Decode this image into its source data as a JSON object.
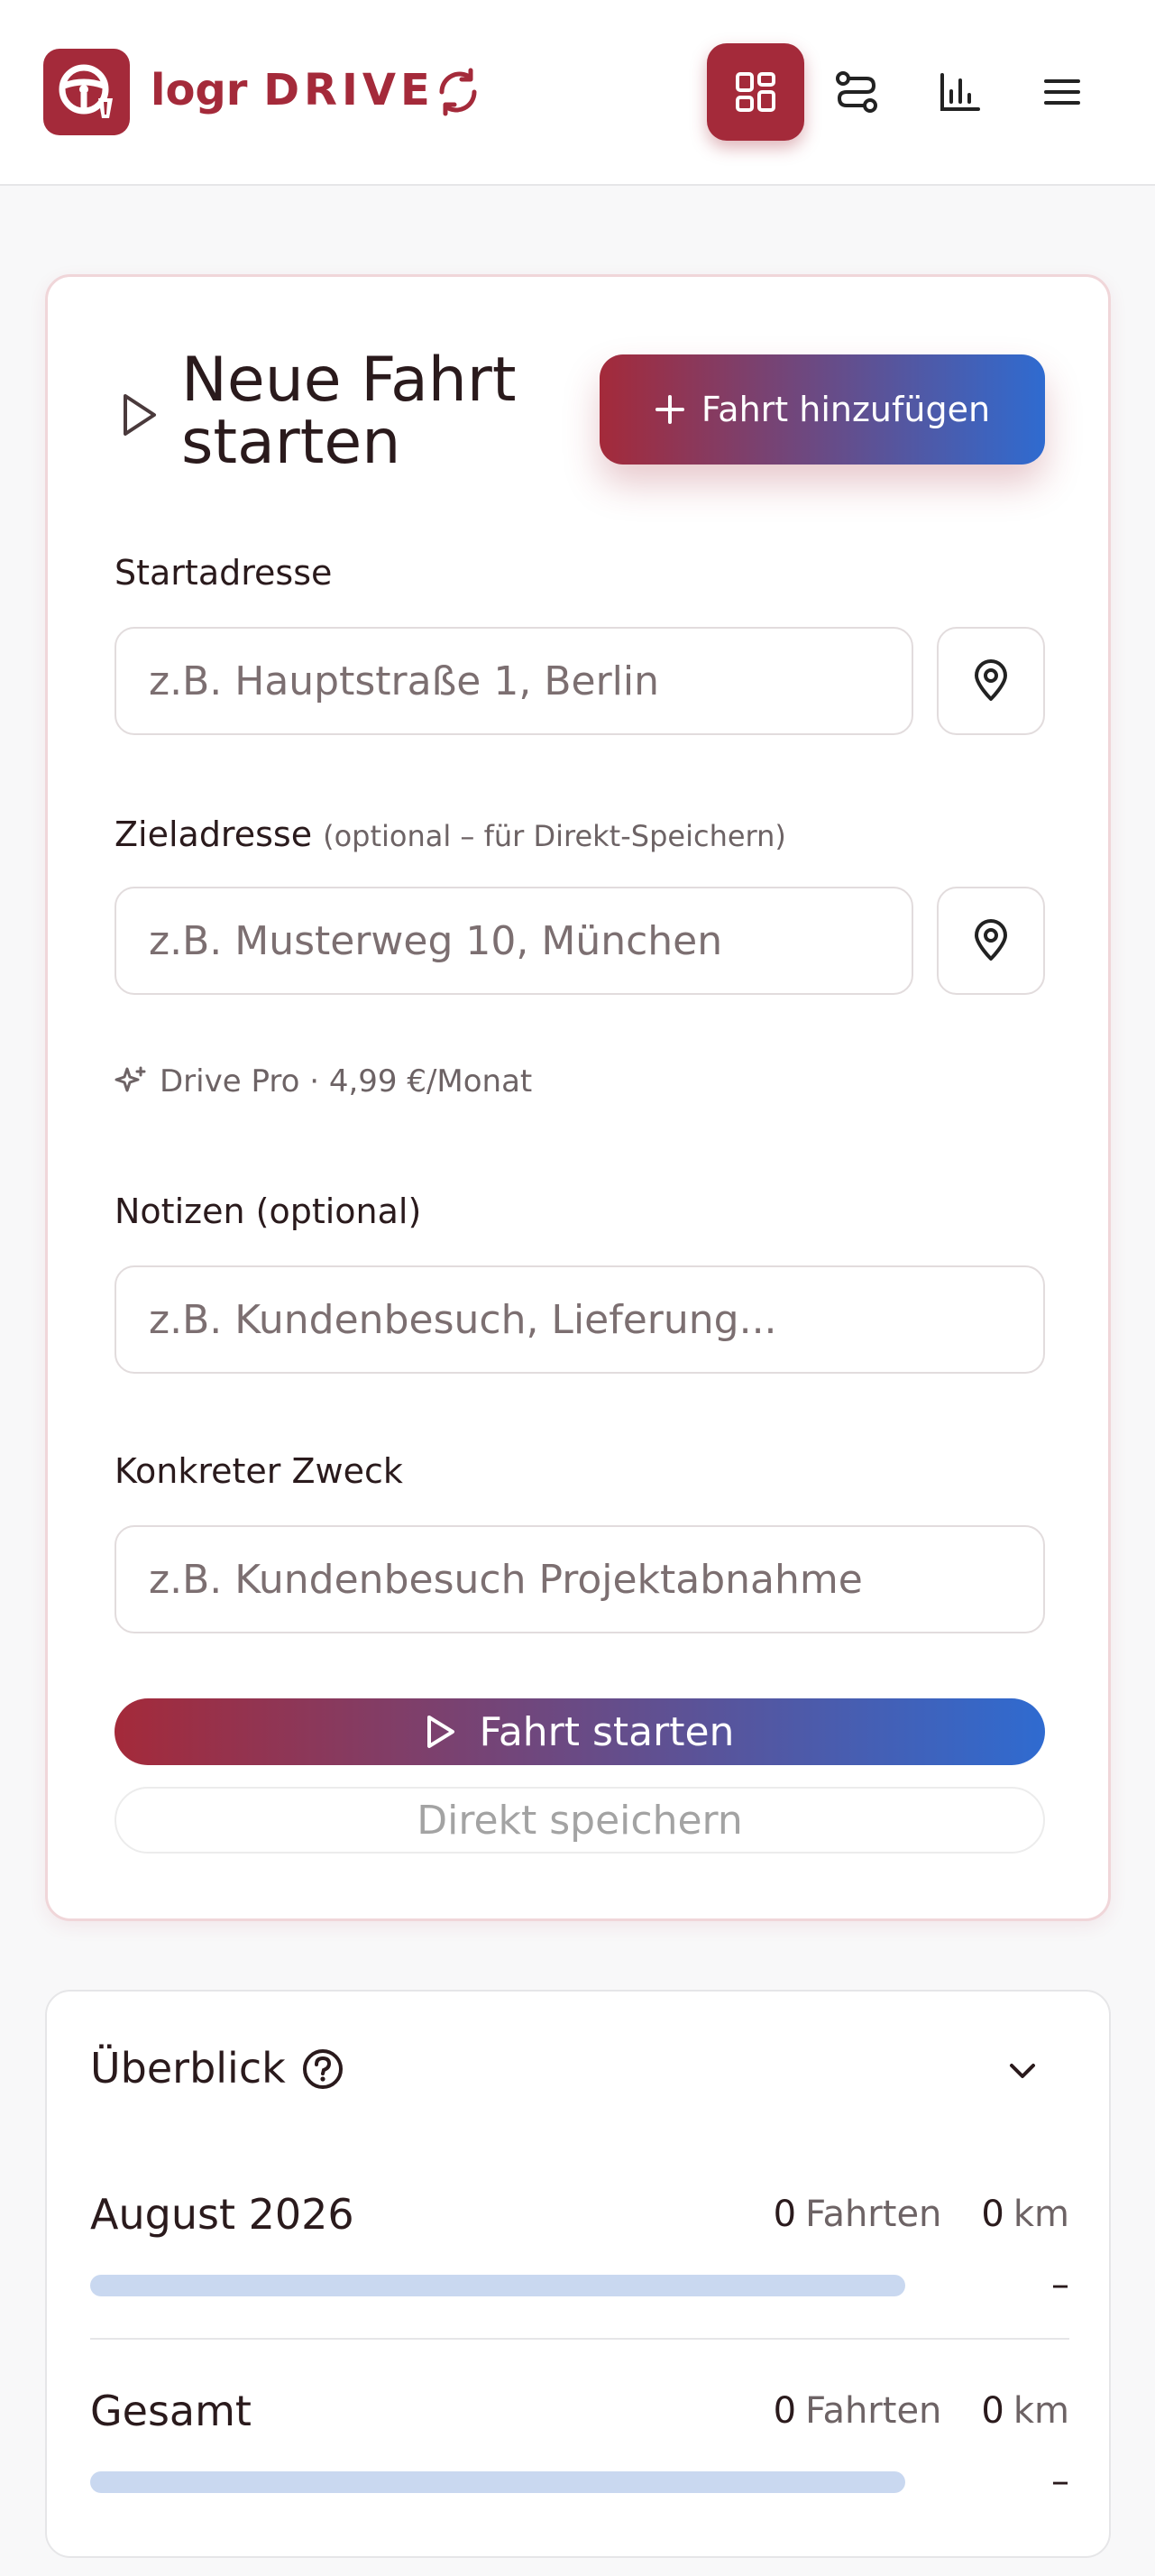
{
  "header": {
    "brand_part1": "logr",
    "brand_part2": "DRIVE",
    "nav": [
      "dashboard",
      "routes",
      "statistics",
      "menu"
    ],
    "colors": {
      "accent": "#a42a3a",
      "gradient_end": "#2f6bd0"
    }
  },
  "trip_form": {
    "title": "Neue Fahrt starten",
    "add_button": "Fahrt hinzufügen",
    "start_address": {
      "label": "Startadresse",
      "placeholder": "z.B. Hauptstraße 1, Berlin",
      "value": ""
    },
    "destination_address": {
      "label": "Zieladresse",
      "hint": "(optional – für Direkt-Speichern)",
      "placeholder": "z.B. Musterweg 10, München",
      "value": ""
    },
    "pro_hint": "Drive Pro · 4,99 €/Monat",
    "notes": {
      "label": "Notizen (optional)",
      "placeholder": "z.B. Kundenbesuch, Lieferung...",
      "value": ""
    },
    "purpose": {
      "label": "Konkreter Zweck",
      "placeholder": "z.B. Kundenbesuch Projektabnahme",
      "value": ""
    },
    "start_button": "Fahrt starten",
    "save_button": "Direkt speichern"
  },
  "overview": {
    "title": "Überblick",
    "rows": [
      {
        "label": "August 2026",
        "trips": "0",
        "trips_unit": "Fahrten",
        "km": "0",
        "km_unit": "km",
        "progress": 0,
        "trend": "–"
      },
      {
        "label": "Gesamt",
        "trips": "0",
        "trips_unit": "Fahrten",
        "km": "0",
        "km_unit": "km",
        "progress": 0,
        "trend": "–"
      }
    ]
  }
}
